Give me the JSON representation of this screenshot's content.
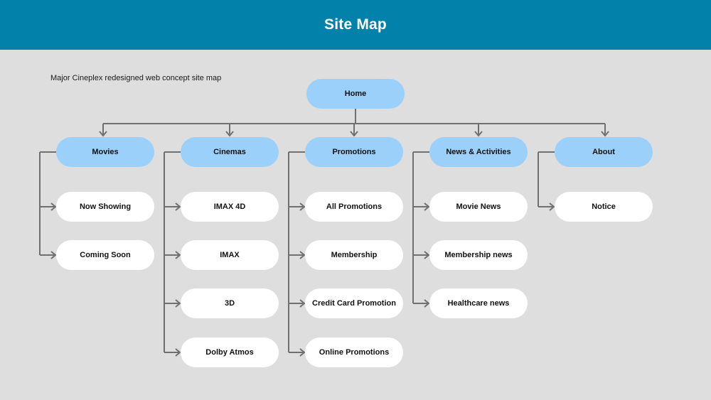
{
  "header": {
    "title": "Site Map"
  },
  "subtitle": "Major Cineplex redesigned web concept site map",
  "colors": {
    "header_bg": "#0282aa",
    "page_bg": "#dedede",
    "primary_node": "#9bd0fb",
    "child_node": "#ffffff",
    "connector": "#707070"
  },
  "root": {
    "label": "Home"
  },
  "categories": [
    {
      "label": "Movies",
      "children": [
        "Now Showing",
        "Coming Soon"
      ]
    },
    {
      "label": "Cinemas",
      "children": [
        "IMAX 4D",
        "IMAX",
        "3D",
        "Dolby Atmos"
      ]
    },
    {
      "label": "Promotions",
      "children": [
        "All Promotions",
        "Membership",
        "Credit Card Promotion",
        "Online Promotions"
      ]
    },
    {
      "label": "News & Activities",
      "children": [
        "Movie News",
        "Membership news",
        "Healthcare news"
      ]
    },
    {
      "label": "About",
      "children": [
        "Notice"
      ]
    }
  ]
}
